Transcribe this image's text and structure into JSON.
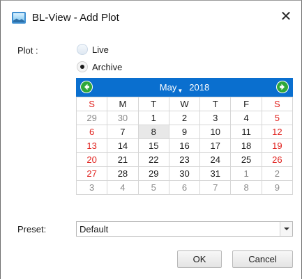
{
  "window": {
    "title": "BL-View - Add Plot",
    "close_glyph": "✕",
    "app_icon": "bl-view-app-icon"
  },
  "plot": {
    "label": "Plot :",
    "options": [
      {
        "label": "Live",
        "selected": false
      },
      {
        "label": "Archive",
        "selected": true
      }
    ]
  },
  "calendar": {
    "month": "May",
    "year": "2018",
    "prev_icon": "arrow-left-circle-icon",
    "next_icon": "arrow-right-circle-icon",
    "header_color": "#0a6fcf",
    "weekend_color": "#e0201c",
    "weekdays": [
      "S",
      "M",
      "T",
      "W",
      "T",
      "F",
      "S"
    ],
    "selected_day": "8",
    "weeks": [
      [
        {
          "d": "29",
          "m": true
        },
        {
          "d": "30",
          "m": true
        },
        {
          "d": "1"
        },
        {
          "d": "2"
        },
        {
          "d": "3"
        },
        {
          "d": "4"
        },
        {
          "d": "5"
        }
      ],
      [
        {
          "d": "6"
        },
        {
          "d": "7"
        },
        {
          "d": "8"
        },
        {
          "d": "9"
        },
        {
          "d": "10"
        },
        {
          "d": "11"
        },
        {
          "d": "12"
        }
      ],
      [
        {
          "d": "13"
        },
        {
          "d": "14"
        },
        {
          "d": "15"
        },
        {
          "d": "16"
        },
        {
          "d": "17"
        },
        {
          "d": "18"
        },
        {
          "d": "19"
        }
      ],
      [
        {
          "d": "20"
        },
        {
          "d": "21"
        },
        {
          "d": "22"
        },
        {
          "d": "23"
        },
        {
          "d": "24"
        },
        {
          "d": "25"
        },
        {
          "d": "26"
        }
      ],
      [
        {
          "d": "27"
        },
        {
          "d": "28"
        },
        {
          "d": "29"
        },
        {
          "d": "30"
        },
        {
          "d": "31"
        },
        {
          "d": "1",
          "m": true
        },
        {
          "d": "2",
          "m": true
        }
      ],
      [
        {
          "d": "3",
          "m": true
        },
        {
          "d": "4",
          "m": true
        },
        {
          "d": "5",
          "m": true
        },
        {
          "d": "6",
          "m": true
        },
        {
          "d": "7",
          "m": true
        },
        {
          "d": "8",
          "m": true
        },
        {
          "d": "9",
          "m": true
        }
      ]
    ]
  },
  "preset": {
    "label": "Preset:",
    "value": "Default"
  },
  "buttons": {
    "ok": "OK",
    "cancel": "Cancel"
  }
}
